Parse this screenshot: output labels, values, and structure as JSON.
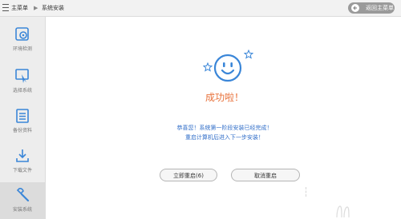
{
  "breadcrumb": {
    "home": "主菜单",
    "current": "系统安装"
  },
  "header": {
    "back_label": "返回主菜单"
  },
  "sidebar": {
    "items": [
      {
        "label": "环境检测",
        "icon": "gear-icon"
      },
      {
        "label": "选择系统",
        "icon": "monitor-cursor-icon"
      },
      {
        "label": "备份资料",
        "icon": "document-list-icon"
      },
      {
        "label": "下载文件",
        "icon": "download-icon"
      },
      {
        "label": "安装系统",
        "icon": "wrench-icon"
      }
    ],
    "active_index": 4
  },
  "main": {
    "status_title": "成功啦！",
    "message_line1": "恭喜您！系统第一阶段安装已经完成！",
    "message_line2": "重启计算机后进入下一步安装！",
    "restart_button": "立即重启(6)",
    "cancel_button": "取消重启"
  },
  "colors": {
    "accent_blue": "#3a86d8",
    "title_orange": "#e8713a",
    "message_blue": "#2f6dc8"
  }
}
